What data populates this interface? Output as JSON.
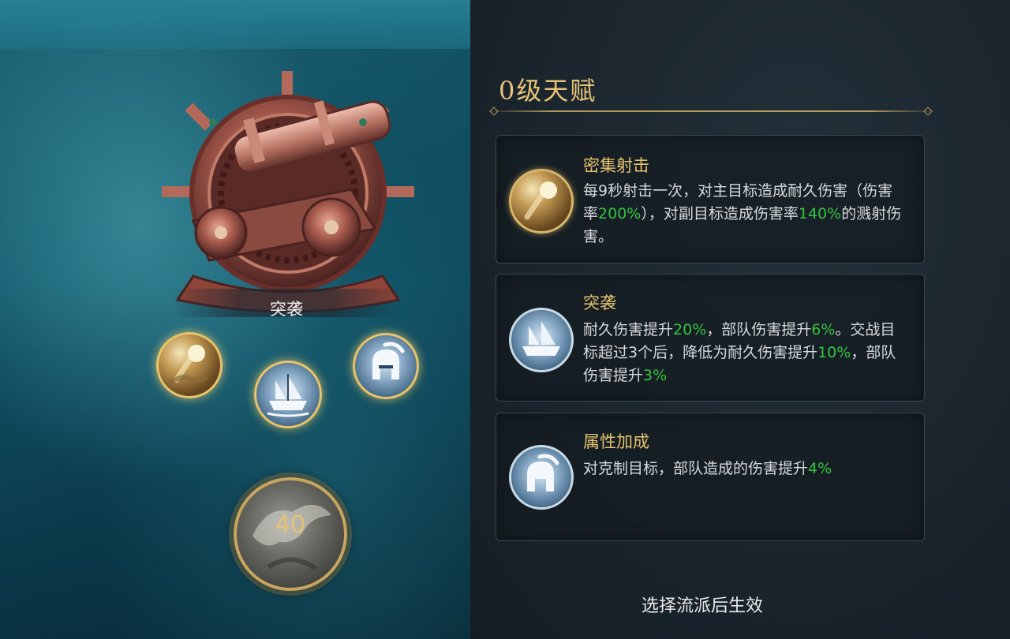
{
  "panel": {
    "title": "0级天赋",
    "footer": "选择流派后生效"
  },
  "emblem": {
    "label": "突袭",
    "icon": "cannon-icon"
  },
  "nodes": [
    {
      "name": "rapid-fire-node",
      "icon": "cannonball-icon",
      "selected": true
    },
    {
      "name": "assault-node",
      "icon": "ship-icon",
      "selected": true
    },
    {
      "name": "attribute-node",
      "icon": "helmet-icon",
      "selected": true
    }
  ],
  "level": {
    "value": "40",
    "icon": "eagle-icon"
  },
  "talents": [
    {
      "name": "密集射击",
      "icon": "cannonball-icon",
      "desc_parts": [
        "每9秒射击一次，对主目标造成耐久伤害（伤害率",
        "200%",
        "），对副目标造成伤害率",
        "140%",
        "的溅射伤害。"
      ]
    },
    {
      "name": "突袭",
      "icon": "ship-icon",
      "desc_parts": [
        "耐久伤害提升",
        "20%",
        "，部队伤害提升",
        "6%",
        "。交战目标超过3个后，降低为耐久伤害提升",
        "10%",
        "，部队伤害提升",
        "3%",
        ""
      ]
    },
    {
      "name": "属性加成",
      "icon": "helmet-icon",
      "desc_parts": [
        "对克制目标，部队造成的伤害提升",
        "4%",
        ""
      ]
    }
  ],
  "colors": {
    "gold": "#e6c46e",
    "highlight_green": "#35c43f",
    "text": "#d8dadc"
  }
}
